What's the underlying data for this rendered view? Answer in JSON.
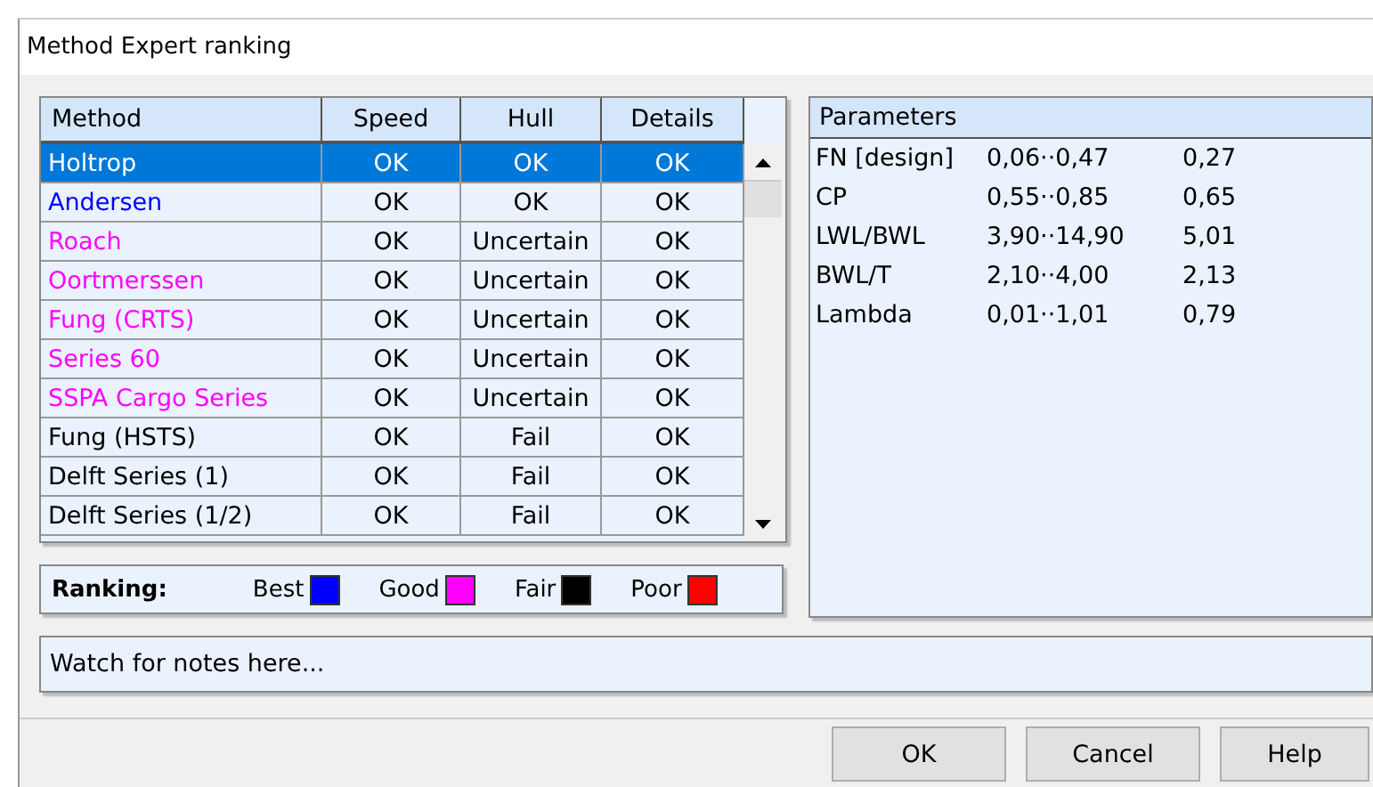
{
  "window": {
    "title": "Method Expert ranking"
  },
  "table": {
    "columns": [
      "Method",
      "Speed",
      "Hull",
      "Details"
    ],
    "rows": [
      {
        "method": "Holtrop",
        "speed": "OK",
        "hull": "OK",
        "details": "OK",
        "selected": true
      },
      {
        "method": "Andersen",
        "speed": "OK",
        "hull": "OK",
        "details": "OK",
        "color": "#0000ff",
        "selected": false
      },
      {
        "method": "Roach",
        "speed": "OK",
        "hull": "Uncertain",
        "details": "OK",
        "color": "#ff00ff",
        "selected": false
      },
      {
        "method": "Oortmerssen",
        "speed": "OK",
        "hull": "Uncertain",
        "details": "OK",
        "color": "#ff00ff",
        "selected": false
      },
      {
        "method": "Fung (CRTS)",
        "speed": "OK",
        "hull": "Uncertain",
        "details": "OK",
        "color": "#ff00ff",
        "selected": false
      },
      {
        "method": "Series 60",
        "speed": "OK",
        "hull": "Uncertain",
        "details": "OK",
        "color": "#ff00ff",
        "selected": false
      },
      {
        "method": "SSPA Cargo Series",
        "speed": "OK",
        "hull": "Uncertain",
        "details": "OK",
        "color": "#ff00ff",
        "selected": false
      },
      {
        "method": "Fung (HSTS)",
        "speed": "OK",
        "hull": "Fail",
        "details": "OK",
        "color": "#000000",
        "selected": false
      },
      {
        "method": "Delft Series (1)",
        "speed": "OK",
        "hull": "Fail",
        "details": "OK",
        "color": "#000000",
        "selected": false
      },
      {
        "method": "Delft Series (1/2)",
        "speed": "OK",
        "hull": "Fail",
        "details": "OK",
        "color": "#000000",
        "selected": false
      }
    ]
  },
  "ranking": {
    "label": "Ranking:",
    "items": [
      {
        "label": "Best",
        "color": "#0000ff"
      },
      {
        "label": "Good",
        "color": "#ff00ff"
      },
      {
        "label": "Fair",
        "color": "#000000"
      },
      {
        "label": "Poor",
        "color": "#ff0000"
      }
    ]
  },
  "parameters": {
    "title": "Parameters",
    "rows": [
      {
        "name": "FN [design]",
        "range": "0,06··0,47",
        "value": "0,27"
      },
      {
        "name": "CP",
        "range": "0,55··0,85",
        "value": "0,65"
      },
      {
        "name": "LWL/BWL",
        "range": "3,90··14,90",
        "value": "5,01"
      },
      {
        "name": "BWL/T",
        "range": "2,10··4,00",
        "value": "2,13"
      },
      {
        "name": "Lambda",
        "range": "0,01··1,01",
        "value": "0,79"
      }
    ]
  },
  "notes": "Watch for notes here...",
  "buttons": [
    "OK",
    "Cancel",
    "Help"
  ]
}
